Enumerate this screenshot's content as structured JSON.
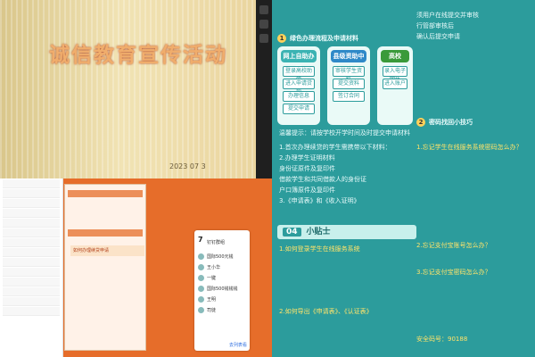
{
  "slide": {
    "title": "诚信教育宣传活动",
    "date": "2023 07 3"
  },
  "doc": {
    "sec1": "绿色办理流程及申请材料",
    "flow": {
      "col1": {
        "header": "网上自助办理",
        "items": [
          "登录高校助学",
          "进入申请贷款",
          "办理信息",
          "提交申请"
        ]
      },
      "col2": {
        "header": "县级资助中心",
        "items": [
          "审核学生资料",
          "提交资料",
          "签订合同"
        ]
      },
      "col3": {
        "header": "高校",
        "items": [
          "录入电子回执",
          "进入账户"
        ]
      }
    },
    "note": "温馨提示：请按学校开学时间及时提交申请材料",
    "materials": [
      "1.首次办理续贷的学生需携带以下材料：",
      "2.办理学生证明材料",
      "身份证原件及复印件",
      "借款学生和共同借款人的身份证",
      "户口簿原件及复印件",
      "3.《申请表》和《收入证明》"
    ],
    "sec2": "密码找回小技巧",
    "sec3_box": "小贴士",
    "tip1": "1.如何登录学生在线服务系统",
    "tip2": "2.如何导出《申请表》、《认证表》",
    "right_text": [
      "须用户在线提交并审核",
      "行管部审核后",
      "确认后提交申请",
      "1.忘记学生在线服务系统密码怎么办？",
      "2.忘记支付宝账号怎么办？",
      "3.忘记支付宝密码怎么办？"
    ],
    "yellow_note": "安全码号：90188"
  },
  "app": {
    "tip": "如何办理续贷申请",
    "card_big": "7",
    "card_title": "钉钉群组",
    "card_names": [
      "国际500元钱",
      "王小华",
      "一键",
      "国际500钱钱钱",
      "王明",
      "司徒"
    ],
    "card_btn": "去列表看"
  }
}
